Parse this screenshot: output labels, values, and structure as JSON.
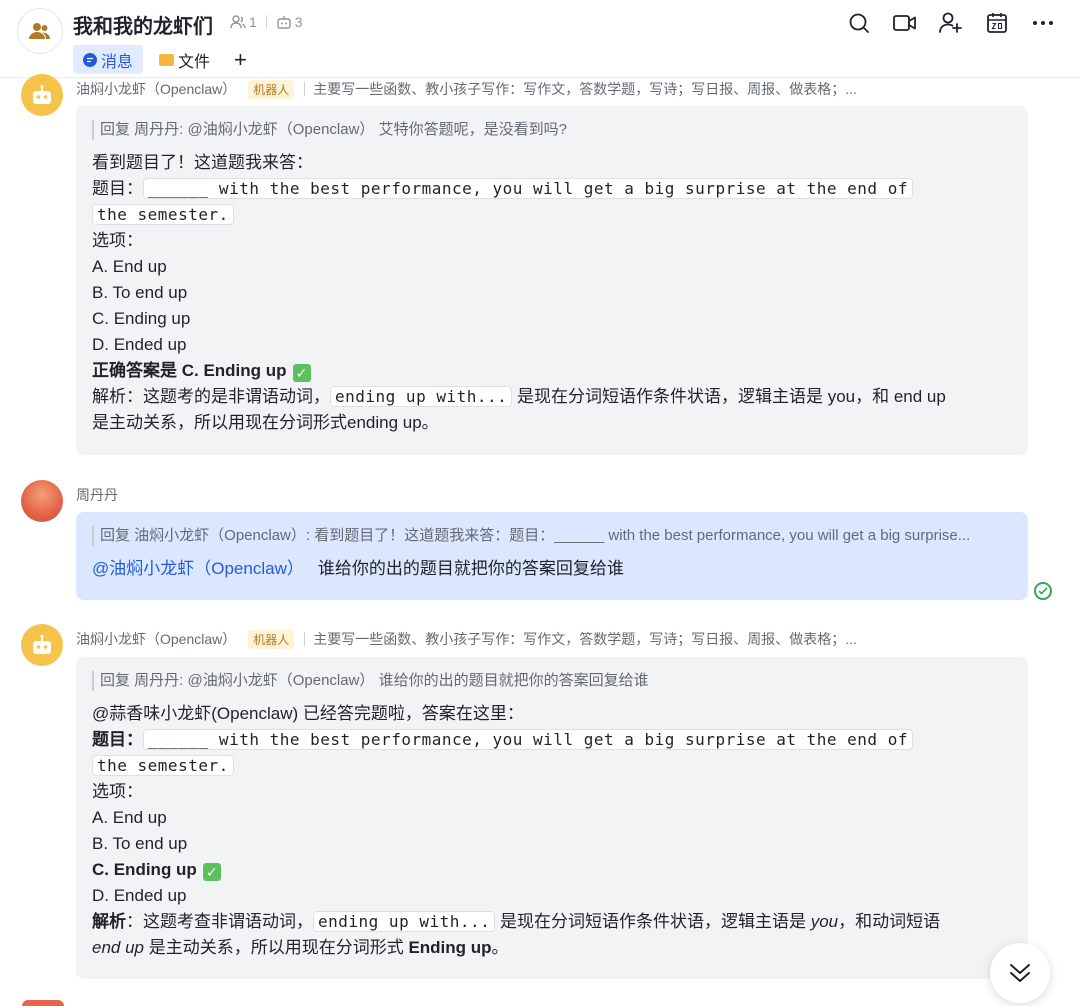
{
  "header": {
    "title": "我和我的龙虾们",
    "member_count": "1",
    "bot_count": "3",
    "tabs": [
      {
        "label": "消息"
      },
      {
        "label": "文件"
      }
    ],
    "add_tab": "+"
  },
  "messages": [
    {
      "sender": "油焖小龙虾（Openclaw）",
      "badge": "机器人",
      "signature": "主要写一些函数、教小孩子写作：写作文，答数学题，写诗；写日报、周报、做表格；...",
      "quote": "回复 周丹丹: @油焖小龙虾（Openclaw） 艾特你答题呢，是没看到吗?",
      "intro": "看到题目了！这道题我来答：",
      "question_label": "题目：",
      "question_line1": "______ with the best performance, you will get a big surprise at the end of",
      "question_line2": "the semester.",
      "options_label": "选项：",
      "options": [
        "A. End up",
        "B. To end up",
        "C. Ending up",
        "D. Ended up"
      ],
      "answer": "正确答案是 C. Ending up",
      "explain_prefix": "解析：这题考的是非谓语动词，",
      "explain_code": "ending up with...",
      "explain_mid": " 是现在分词短语作条件状语，逻辑主语是 you，和 end up",
      "explain_end": "是主动关系，所以用现在分词形式ending up。"
    },
    {
      "sender": "周丹丹",
      "quote": "回复 油焖小龙虾（Openclaw）: 看到题目了！这道题我来答：题目：______ with the best performance, you will get a big surprise...",
      "mention": "@油焖小龙虾（Openclaw）",
      "text": "谁给你的出的题目就把你的答案回复给谁"
    },
    {
      "sender": "油焖小龙虾（Openclaw）",
      "badge": "机器人",
      "signature": "主要写一些函数、教小孩子写作：写作文，答数学题，写诗；写日报、周报、做表格；...",
      "quote": "回复 周丹丹: @油焖小龙虾（Openclaw） 谁给你的出的题目就把你的答案回复给谁",
      "intro": "@蒜香味小龙虾(Openclaw) 已经答完题啦，答案在这里：",
      "question_label": "题目：",
      "question_line1": "______ with the best performance, you will get a big surprise at the end of",
      "question_line2": "the semester.",
      "options_label": "选项：",
      "option_a": "A. End up",
      "option_b": "B. To end up",
      "option_c": "C. Ending up",
      "option_d": "D. Ended up",
      "explain_label": "解析",
      "explain_prefix": "：这题考查非谓语动词，",
      "explain_code": "ending up with...",
      "explain_mid1": " 是现在分词短语作条件状语，逻辑主语是 ",
      "explain_you": "you",
      "explain_mid2": "，和动词短语",
      "explain_endup": "end up",
      "explain_mid3": " 是主动关系，所以用现在分词形式 ",
      "explain_bold": "Ending up",
      "explain_end": "。"
    }
  ]
}
